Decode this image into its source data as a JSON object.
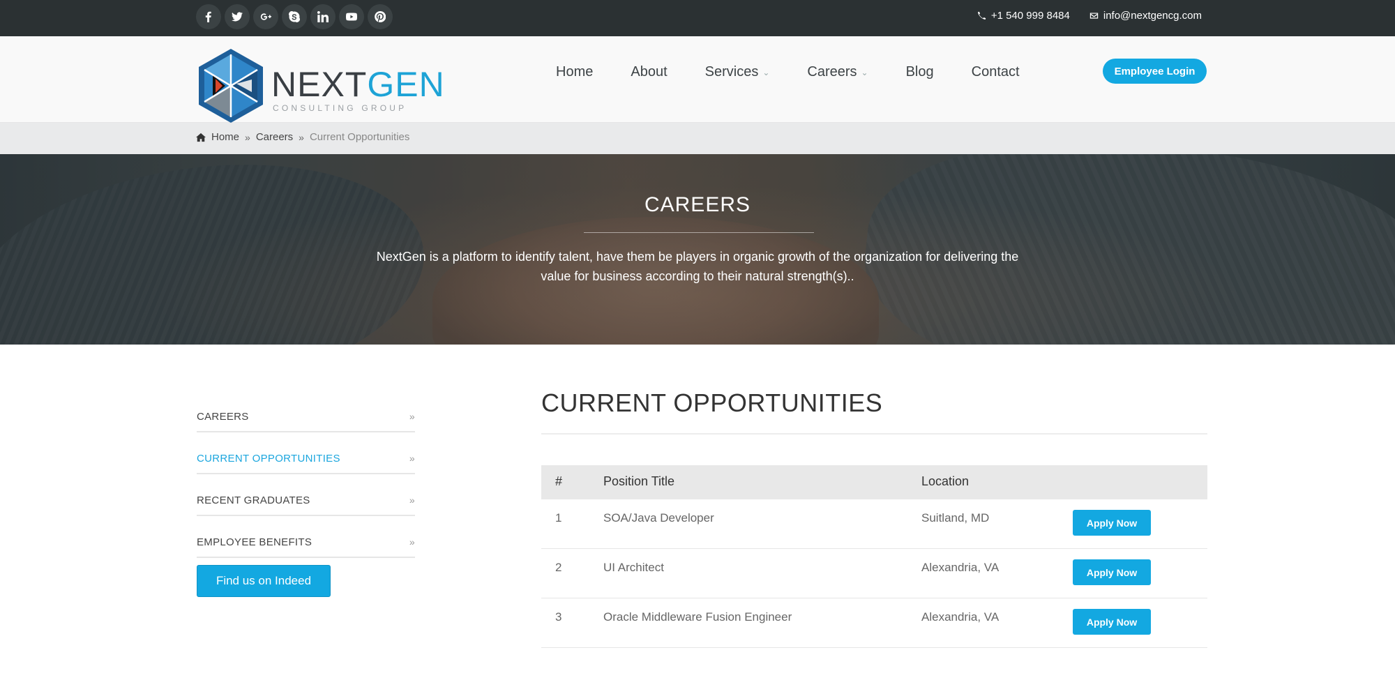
{
  "topbar": {
    "social_icons": [
      "facebook-icon",
      "twitter-icon",
      "google-plus-icon",
      "skype-icon",
      "linkedin-icon",
      "youtube-icon",
      "pinterest-icon"
    ],
    "phone": "+1 540 999 8484",
    "email": "info@nextgencg.com"
  },
  "header": {
    "logo": {
      "brand_next": "NEXT",
      "brand_gen": "GEN",
      "tagline": "CONSULTING GROUP"
    },
    "nav": [
      {
        "label": "Home"
      },
      {
        "label": "About"
      },
      {
        "label": "Services"
      },
      {
        "label": "Careers"
      },
      {
        "label": "Blog"
      },
      {
        "label": "Contact"
      }
    ],
    "login_label": "Employee Login"
  },
  "breadcrumb": {
    "home": "Home",
    "careers": "Careers",
    "current": "Current Opportunities"
  },
  "hero": {
    "title": "CAREERS",
    "text": "NextGen is a platform to identify talent, have them be players in organic growth of the organization for delivering the value for business according to their natural strength(s).."
  },
  "sidebar": {
    "items": [
      {
        "label": "CAREERS"
      },
      {
        "label": "CURRENT OPPORTUNITIES"
      },
      {
        "label": "RECENT GRADUATES"
      },
      {
        "label": "EMPLOYEE BENEFITS"
      }
    ],
    "indeed_label": "Find us on Indeed"
  },
  "main": {
    "title": "CURRENT OPPORTUNITIES",
    "table": {
      "headers": [
        "#",
        "Position Title",
        "Location"
      ],
      "rows": [
        {
          "num": "1",
          "title": "SOA/Java Developer",
          "location": "Suitland, MD",
          "action": "Apply Now"
        },
        {
          "num": "2",
          "title": "UI Architect",
          "location": "Alexandria, VA",
          "action": "Apply Now"
        },
        {
          "num": "3",
          "title": "Oracle Middleware Fusion Engineer",
          "location": "Alexandria, VA",
          "action": "Apply Now"
        }
      ]
    }
  },
  "colors": {
    "accent": "#13a8e1",
    "topbar": "#2b3133",
    "text": "#333333"
  }
}
